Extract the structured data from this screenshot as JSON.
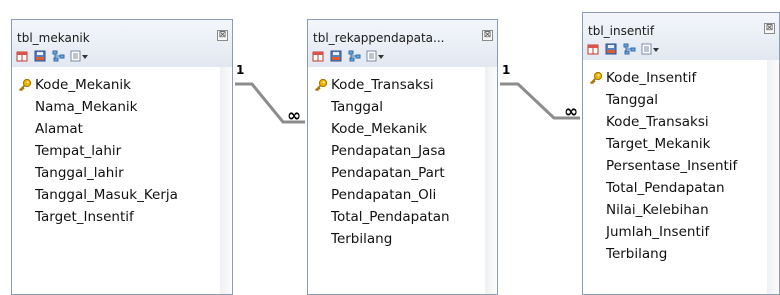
{
  "tables": [
    {
      "title": "tbl_mekanik",
      "close_glyph": "⊠",
      "key_field": "Kode_Mekanik",
      "fields": [
        "Nama_Mekanik",
        "Alamat",
        "Tempat_lahir",
        "Tanggal_lahir",
        "Tanggal_Masuk_Kerja",
        "Target_Insentif"
      ]
    },
    {
      "title": "tbl_rekappendapata...",
      "close_glyph": "⊠",
      "key_field": "Kode_Transaksi",
      "fields": [
        "Tanggal",
        "Kode_Mekanik",
        "Pendapatan_Jasa",
        "Pendapatan_Part",
        "Pendapatan_Oli",
        "Total_Pendapatan",
        "Terbilang"
      ]
    },
    {
      "title": "tbl_insentif",
      "close_glyph": "⊠",
      "key_field": "Kode_Insentif",
      "fields": [
        "Tanggal",
        "Kode_Transaksi",
        "Target_Mekanik",
        "Persentase_Insentif",
        "Total_Pendapatan",
        "Nilai_Kelebihan",
        "Jumlah_Insentif",
        "Terbilang"
      ]
    }
  ],
  "relationships": [
    {
      "one_label": "1",
      "many_label": "∞"
    },
    {
      "one_label": "1",
      "many_label": "∞"
    }
  ],
  "colors": {
    "header_bg": "#e8edf5",
    "border": "#8a9bb5",
    "key": "#e7a400",
    "line": "#707070"
  }
}
